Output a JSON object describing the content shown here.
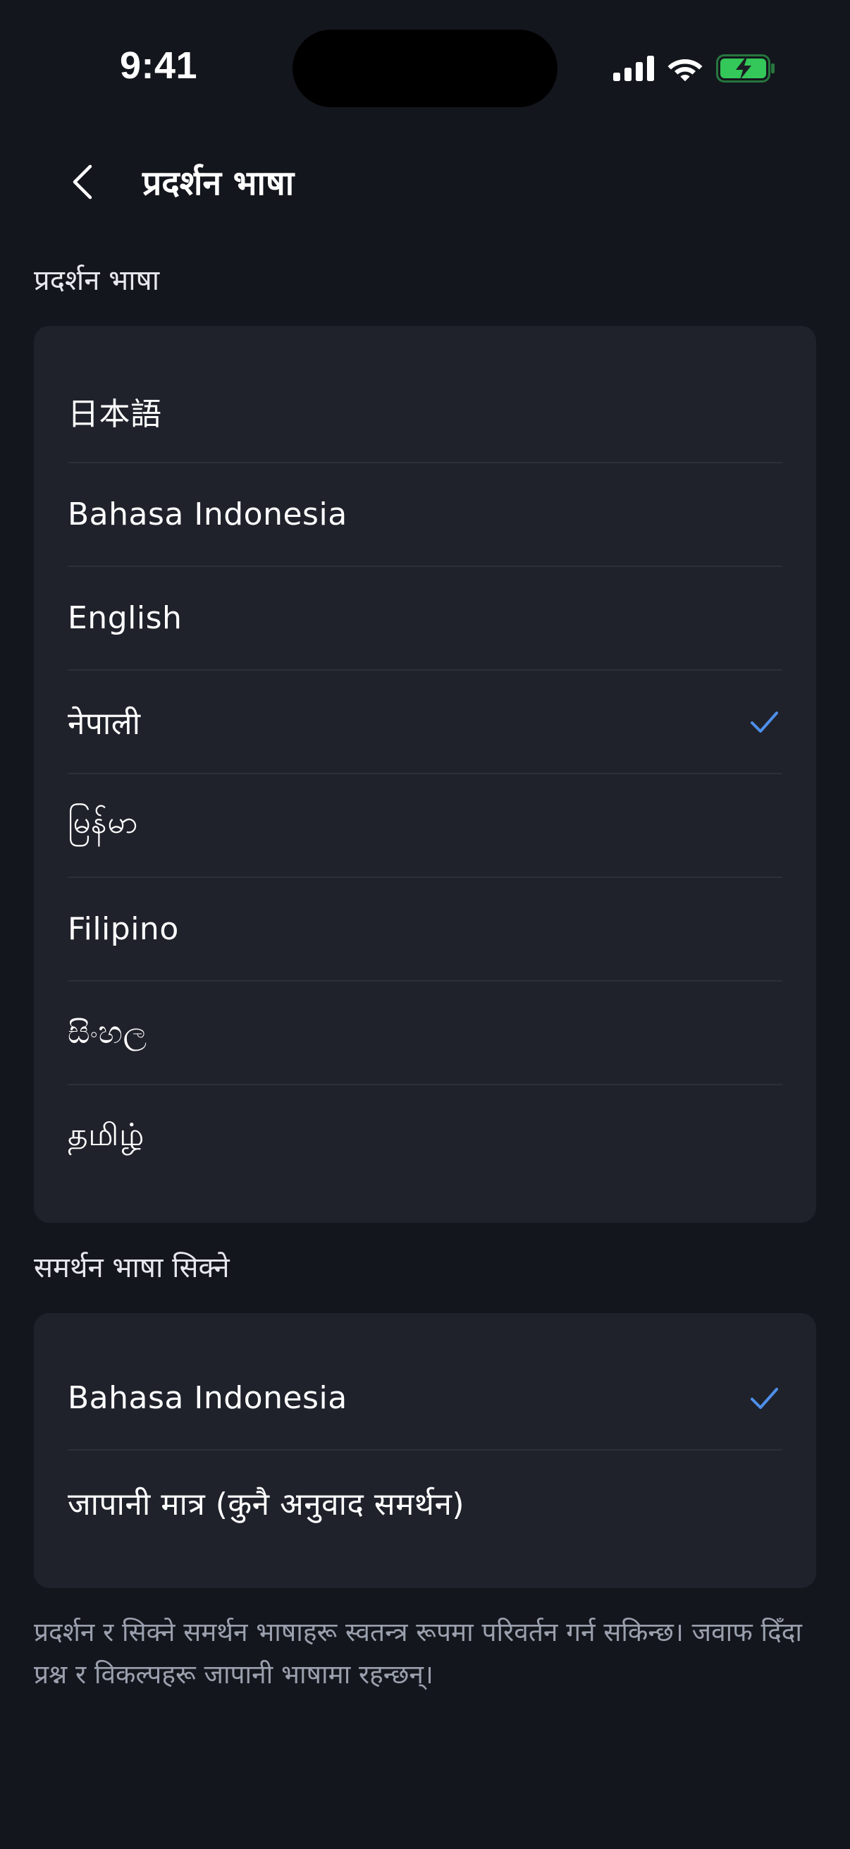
{
  "status_bar": {
    "time": "9:41"
  },
  "header": {
    "back_icon": "chevron-left-icon",
    "title": "प्रदर्शन भाषा"
  },
  "display_language_section": {
    "label": "प्रदर्शन भाषा",
    "items": [
      {
        "label": "日本語",
        "selected": false
      },
      {
        "label": "Bahasa Indonesia",
        "selected": false
      },
      {
        "label": "English",
        "selected": false
      },
      {
        "label": "नेपाली",
        "selected": true
      },
      {
        "label": "မြန်မာ",
        "selected": false
      },
      {
        "label": "Filipino",
        "selected": false
      },
      {
        "label": "සිංහල",
        "selected": false
      },
      {
        "label": "தமிழ்",
        "selected": false
      }
    ]
  },
  "support_language_section": {
    "label": "समर्थन भाषा सिक्ने",
    "items": [
      {
        "label": "Bahasa Indonesia",
        "selected": true
      },
      {
        "label": "जापानी मात्र (कुनै अनुवाद समर्थन)",
        "selected": false
      }
    ]
  },
  "footer": {
    "note": "प्रदर्शन र सिक्ने समर्थन भाषाहरू स्वतन्त्र रूपमा परिवर्तन गर्न सकिन्छ। जवाफ दिँदा प्रश्न र विकल्पहरू जापानी भाषामा रहन्छन्।"
  },
  "colors": {
    "background": "#14161d",
    "card": "#1f222b",
    "accent_check": "#4f8fea",
    "battery": "#34c759"
  }
}
